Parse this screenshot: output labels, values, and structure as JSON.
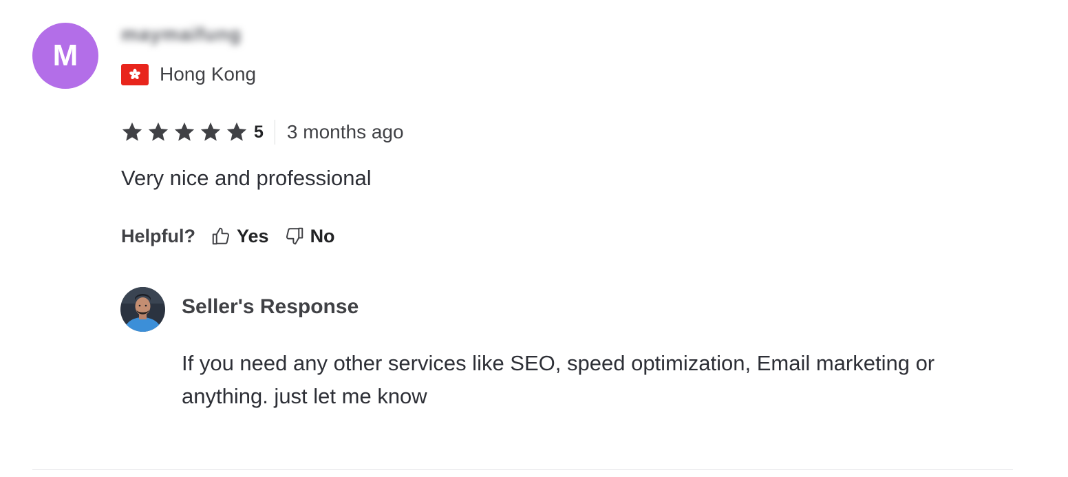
{
  "reviewer": {
    "avatar_letter": "M",
    "avatar_color": "#b36ee8",
    "username": "maymaifung",
    "country": "Hong Kong",
    "flag_icon": "hong-kong-flag-icon"
  },
  "review": {
    "rating": 5,
    "rating_label": "5",
    "time_ago": "3 months ago",
    "text": "Very nice and professional"
  },
  "helpful": {
    "label": "Helpful?",
    "yes_label": "Yes",
    "no_label": "No"
  },
  "seller_response": {
    "title": "Seller's Response",
    "text": "If you need any other services like SEO, speed optimization, Email marketing or anything. just let me know"
  },
  "colors": {
    "star": "#404145",
    "flag_red": "#e8251c",
    "divider": "#e4e5e7"
  }
}
